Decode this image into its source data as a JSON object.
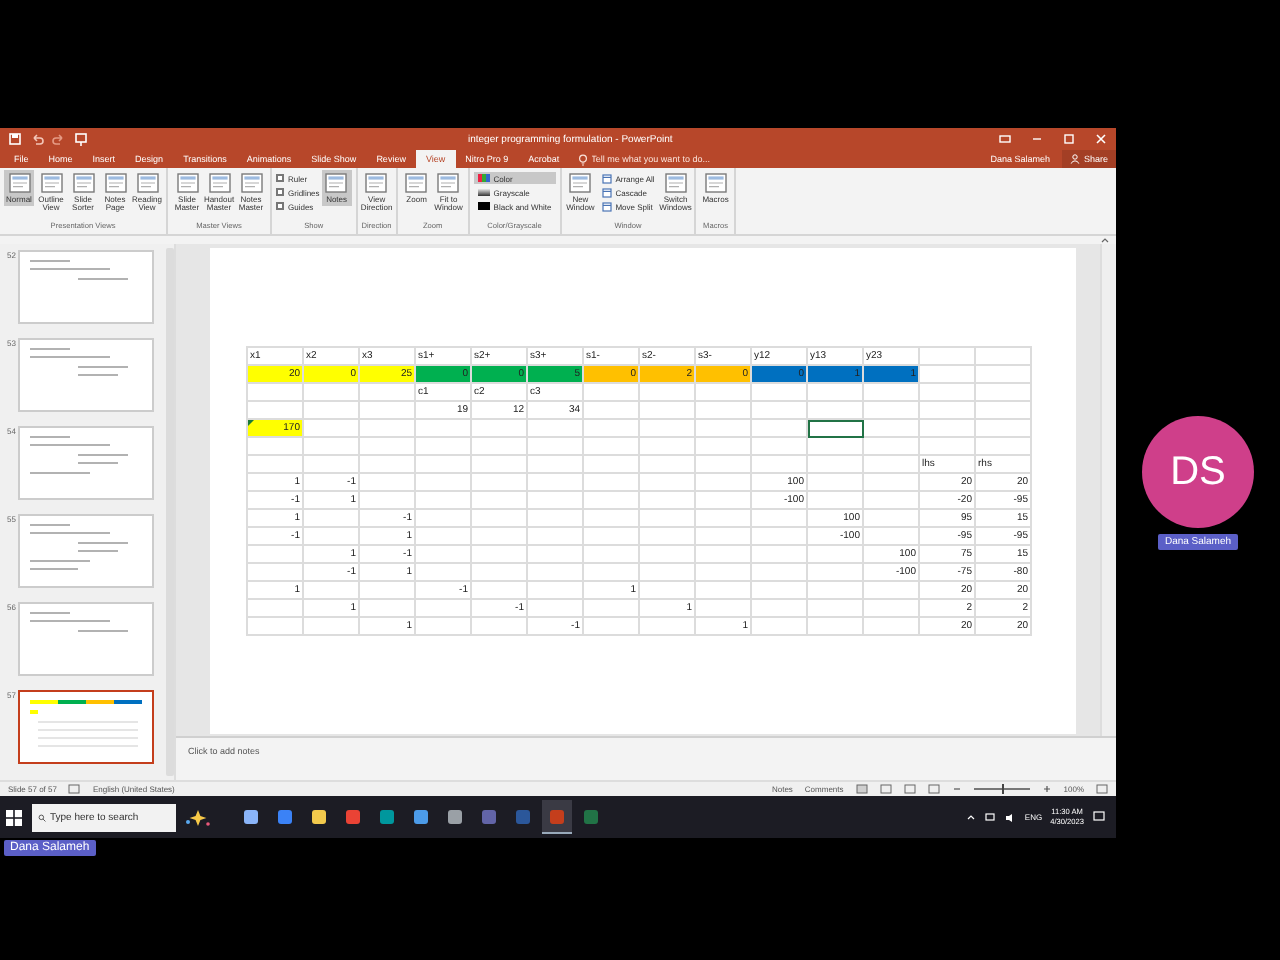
{
  "window": {
    "title": "integer programming formulation - PowerPoint",
    "user": "Dana Salameh",
    "share": "Share"
  },
  "tabs": [
    {
      "label": "File",
      "selected": false
    },
    {
      "label": "Home",
      "selected": false
    },
    {
      "label": "Insert",
      "selected": false
    },
    {
      "label": "Design",
      "selected": false
    },
    {
      "label": "Transitions",
      "selected": false
    },
    {
      "label": "Animations",
      "selected": false
    },
    {
      "label": "Slide Show",
      "selected": false
    },
    {
      "label": "Review",
      "selected": false
    },
    {
      "label": "View",
      "selected": true
    },
    {
      "label": "Nitro Pro 9",
      "selected": false
    },
    {
      "label": "Acrobat",
      "selected": false
    }
  ],
  "tell_me": {
    "placeholder": "Tell me what you want to do..."
  },
  "ribbon": {
    "groups": [
      {
        "label": "Presentation Views",
        "items": [
          {
            "kind": "large",
            "label": "Normal",
            "selected": true
          },
          {
            "kind": "large",
            "label": "Outline View",
            "selected": false
          },
          {
            "kind": "large",
            "label": "Slide Sorter",
            "selected": false
          },
          {
            "kind": "large",
            "label": "Notes Page",
            "selected": false
          },
          {
            "kind": "large",
            "label": "Reading View",
            "selected": false
          }
        ]
      },
      {
        "label": "Master Views",
        "items": [
          {
            "kind": "large",
            "label": "Slide Master",
            "selected": false
          },
          {
            "kind": "large",
            "label": "Handout Master",
            "selected": false
          },
          {
            "kind": "large",
            "label": "Notes Master",
            "selected": false
          }
        ]
      },
      {
        "label": "Show",
        "items": [
          {
            "kind": "check",
            "label": "Ruler",
            "checked": false
          },
          {
            "kind": "check",
            "label": "Gridlines",
            "checked": false
          },
          {
            "kind": "check",
            "label": "Guides",
            "checked": false
          },
          {
            "kind": "large",
            "label": "Notes",
            "selected": true
          }
        ]
      },
      {
        "label": "Direction",
        "items": [
          {
            "kind": "large",
            "label": "View Direction",
            "selected": false
          }
        ]
      },
      {
        "label": "Zoom",
        "items": [
          {
            "kind": "large",
            "label": "Zoom",
            "selected": false
          },
          {
            "kind": "large",
            "label": "Fit to Window",
            "selected": false
          }
        ]
      },
      {
        "label": "Color/Grayscale",
        "items": [
          {
            "kind": "option",
            "label": "Color",
            "selected": true
          },
          {
            "kind": "option",
            "label": "Grayscale",
            "selected": false
          },
          {
            "kind": "option",
            "label": "Black and White",
            "selected": false
          }
        ]
      },
      {
        "label": "Window",
        "items": [
          {
            "kind": "large",
            "label": "New Window",
            "selected": false
          },
          {
            "kind": "small",
            "label": "Arrange All"
          },
          {
            "kind": "small",
            "label": "Cascade"
          },
          {
            "kind": "small",
            "label": "Move Split"
          },
          {
            "kind": "large",
            "label": "Switch Windows",
            "selected": false
          }
        ]
      },
      {
        "label": "Macros",
        "items": [
          {
            "kind": "large",
            "label": "Macros",
            "selected": false
          }
        ]
      }
    ]
  },
  "thumbnails": [
    {
      "number": "52",
      "selected": false
    },
    {
      "number": "53",
      "selected": false
    },
    {
      "number": "54",
      "selected": false
    },
    {
      "number": "55",
      "selected": false
    },
    {
      "number": "56",
      "selected": false
    },
    {
      "number": "57",
      "selected": true
    }
  ],
  "sheet": {
    "rows": [
      {
        "kind": "labels",
        "cells": [
          {
            "text": "x1"
          },
          {
            "text": "x2"
          },
          {
            "text": "x3"
          },
          {
            "text": "s1+"
          },
          {
            "text": "s2+"
          },
          {
            "text": "s3+"
          },
          {
            "text": "s1-"
          },
          {
            "text": "s2-"
          },
          {
            "text": "s3-"
          },
          {
            "text": "y12"
          },
          {
            "text": "y13"
          },
          {
            "text": "y23"
          },
          null,
          null
        ]
      },
      {
        "kind": "numbers",
        "cells": [
          {
            "text": "20",
            "color": "#ffff00"
          },
          {
            "text": "0",
            "color": "#ffff00"
          },
          {
            "text": "25",
            "color": "#ffff00"
          },
          {
            "text": "0",
            "color": "#00b050"
          },
          {
            "text": "0",
            "color": "#00b050"
          },
          {
            "text": "5",
            "color": "#00b050"
          },
          {
            "text": "0",
            "color": "#ffc000"
          },
          {
            "text": "2",
            "color": "#ffc000"
          },
          {
            "text": "0",
            "color": "#ffc000"
          },
          {
            "text": "0",
            "color": "#0070c0"
          },
          {
            "text": "1",
            "color": "#0070c0"
          },
          {
            "text": "1",
            "color": "#0070c0"
          },
          null,
          null
        ]
      },
      {
        "kind": "labels",
        "cells": [
          null,
          null,
          null,
          {
            "text": "c1"
          },
          {
            "text": "c2"
          },
          {
            "text": "c3"
          },
          null,
          null,
          null,
          null,
          null,
          null,
          null,
          null
        ]
      },
      {
        "kind": "numbers",
        "cells": [
          null,
          null,
          null,
          {
            "text": "19"
          },
          {
            "text": "12"
          },
          {
            "text": "34"
          },
          null,
          null,
          null,
          null,
          null,
          null,
          null,
          null
        ]
      },
      {
        "kind": "numbers",
        "cells": [
          {
            "text": "170",
            "color": "#ffff00",
            "flagged": true
          },
          null,
          null,
          null,
          null,
          null,
          null,
          null,
          null,
          null,
          {
            "selected": true
          },
          null,
          null,
          null
        ]
      },
      {
        "kind": "numbers",
        "cells": [
          null,
          null,
          null,
          null,
          null,
          null,
          null,
          null,
          null,
          null,
          null,
          null,
          null,
          null
        ]
      },
      {
        "kind": "labels",
        "cells": [
          null,
          null,
          null,
          null,
          null,
          null,
          null,
          null,
          null,
          null,
          null,
          null,
          {
            "text": "lhs"
          },
          {
            "text": "rhs"
          }
        ]
      },
      {
        "kind": "numbers",
        "cells": [
          {
            "text": "1"
          },
          {
            "text": "-1"
          },
          null,
          null,
          null,
          null,
          null,
          null,
          null,
          {
            "text": "100"
          },
          null,
          null,
          {
            "text": "20"
          },
          {
            "text": "20"
          }
        ]
      },
      {
        "kind": "numbers",
        "cells": [
          {
            "text": "-1"
          },
          {
            "text": "1"
          },
          null,
          null,
          null,
          null,
          null,
          null,
          null,
          {
            "text": "-100"
          },
          null,
          null,
          {
            "text": "-20"
          },
          {
            "text": "-95"
          }
        ]
      },
      {
        "kind": "numbers",
        "cells": [
          {
            "text": "1"
          },
          null,
          {
            "text": "-1"
          },
          null,
          null,
          null,
          null,
          null,
          null,
          null,
          {
            "text": "100"
          },
          null,
          {
            "text": "95"
          },
          {
            "text": "15"
          }
        ]
      },
      {
        "kind": "numbers",
        "cells": [
          {
            "text": "-1"
          },
          null,
          {
            "text": "1"
          },
          null,
          null,
          null,
          null,
          null,
          null,
          null,
          {
            "text": "-100"
          },
          null,
          {
            "text": "-95"
          },
          {
            "text": "-95"
          }
        ]
      },
      {
        "kind": "numbers",
        "cells": [
          null,
          {
            "text": "1"
          },
          {
            "text": "-1"
          },
          null,
          null,
          null,
          null,
          null,
          null,
          null,
          null,
          {
            "text": "100"
          },
          {
            "text": "75"
          },
          {
            "text": "15"
          }
        ]
      },
      {
        "kind": "numbers",
        "cells": [
          null,
          {
            "text": "-1"
          },
          {
            "text": "1"
          },
          null,
          null,
          null,
          null,
          null,
          null,
          null,
          null,
          {
            "text": "-100"
          },
          {
            "text": "-75"
          },
          {
            "text": "-80"
          }
        ]
      },
      {
        "kind": "numbers",
        "cells": [
          {
            "text": "1"
          },
          null,
          null,
          {
            "text": "-1"
          },
          null,
          null,
          {
            "text": "1"
          },
          null,
          null,
          null,
          null,
          null,
          {
            "text": "20"
          },
          {
            "text": "20"
          }
        ]
      },
      {
        "kind": "numbers",
        "cells": [
          null,
          {
            "text": "1"
          },
          null,
          null,
          {
            "text": "-1"
          },
          null,
          null,
          {
            "text": "1"
          },
          null,
          null,
          null,
          null,
          {
            "text": "2"
          },
          {
            "text": "2"
          }
        ]
      },
      {
        "kind": "numbers",
        "cells": [
          null,
          null,
          {
            "text": "1"
          },
          null,
          null,
          {
            "text": "-1"
          },
          null,
          null,
          {
            "text": "1"
          },
          null,
          null,
          null,
          {
            "text": "20"
          },
          {
            "text": "20"
          }
        ]
      }
    ]
  },
  "notes": {
    "placeholder": "Click to add notes"
  },
  "status_bar": {
    "slide": "Slide 57 of 57",
    "language": "English (United States)",
    "notes": "Notes",
    "comments": "Comments",
    "zoom": {
      "level": 0.5
    },
    "zoom_text": "100%"
  },
  "taskbar": {
    "search": {
      "placeholder": "Type here to search"
    },
    "apps": [
      {
        "color": "#8ab4f8",
        "selected": false
      },
      {
        "color": "#3b82f6",
        "selected": false
      },
      {
        "color": "#f2c94c",
        "selected": false
      },
      {
        "color": "#ea4335",
        "selected": false
      },
      {
        "color": "#00979d",
        "selected": false
      },
      {
        "color": "#4c9be8",
        "selected": false
      },
      {
        "color": "#9aa0a6",
        "selected": false
      },
      {
        "color": "#6264a7",
        "selected": false
      },
      {
        "color": "#2b579a",
        "selected": false
      },
      {
        "color": "#c43e1c",
        "selected": true
      },
      {
        "color": "#217346",
        "selected": false
      }
    ],
    "language": "ENG",
    "time": "11:30 AM",
    "date": "4/30/2023"
  },
  "call": {
    "initials": "DS",
    "name": "Dana Salameh",
    "presenter": "Dana Salameh"
  }
}
